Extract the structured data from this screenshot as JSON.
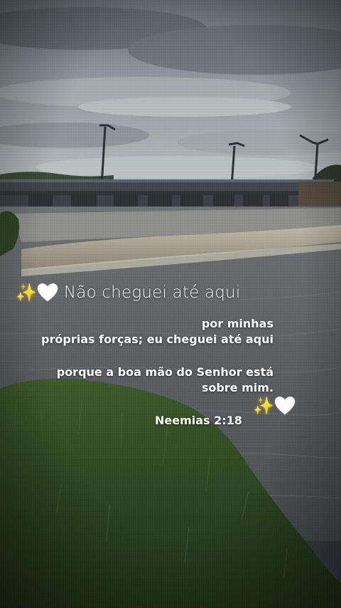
{
  "overlay": {
    "headline": "Não cheguei até aqui",
    "verse_lines": [
      "por minhas",
      "próprias forças; eu cheguei até aqui",
      "porque a boa mão do Senhor está",
      "sobre mim."
    ],
    "reference": "Neemias 2:18",
    "lead_emojis": [
      "sparkles-icon",
      "white-heart-icon"
    ],
    "trail_emojis": [
      "sparkles-icon",
      "white-heart-icon"
    ]
  },
  "colors": {
    "sky": "#8d969c",
    "water": "#5b5f62",
    "grass": "#2f4a24",
    "text": "#ffffff",
    "sparkle": "#f6cf3c"
  }
}
